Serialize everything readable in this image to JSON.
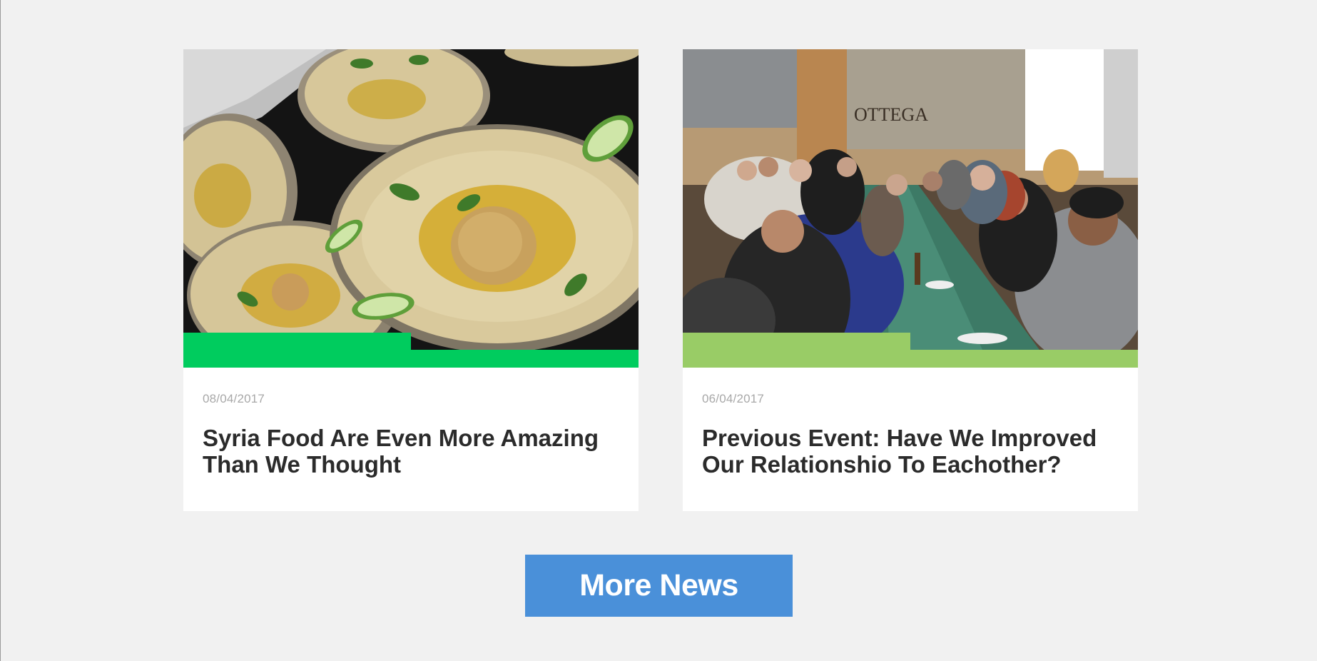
{
  "articles": [
    {
      "date": "08/04/2017",
      "title": "Syria Food Are Even More Amazing Than We Thought",
      "accent_color": "#00cc5e",
      "image": "hummus-plates-photo"
    },
    {
      "date": "06/04/2017",
      "title": "Previous Event: Have We Improved Our Relationshio To Eachother?",
      "accent_color": "#99cc66",
      "image": "community-dinner-photo",
      "sign_text": "OTTEGA"
    }
  ],
  "more_button": {
    "label": "More News",
    "color": "#4a90d9"
  },
  "page_background": "#f1f1f1"
}
